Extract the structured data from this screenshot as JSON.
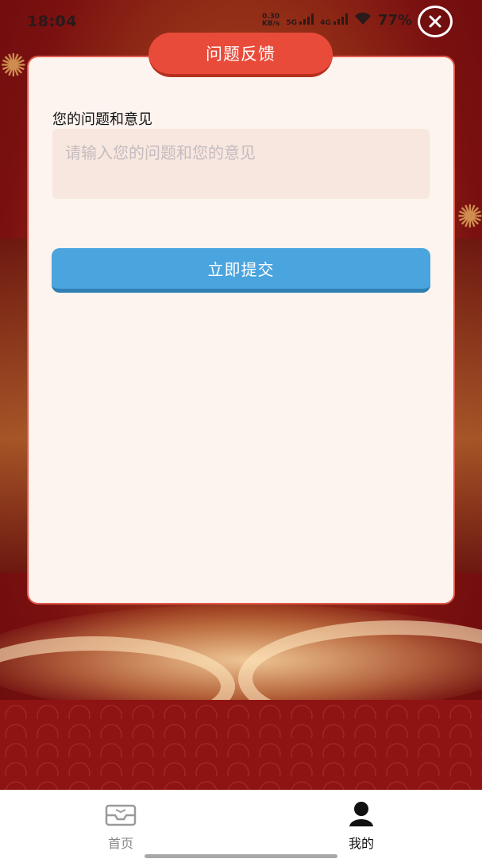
{
  "status_bar": {
    "time": "18:04",
    "net_speed_top": "0.30",
    "net_speed_bottom": "KB/s",
    "sim1_label": "5G",
    "sim2_label": "4G",
    "battery": "77%"
  },
  "dialog": {
    "title": "问题反馈",
    "field_label": "您的问题和意见",
    "textarea_value": "",
    "textarea_placeholder": "请输入您的问题和您的意见",
    "submit_label": "立即提交"
  },
  "tabbar": {
    "items": [
      {
        "label": "首页",
        "icon": "inbox-icon",
        "active": false
      },
      {
        "label": "我的",
        "icon": "user-icon",
        "active": true
      }
    ]
  },
  "colors": {
    "title_tab": "#e94b3a",
    "submit": "#4aa4de",
    "card_bg": "#fdf4ef",
    "textarea_bg": "#f8e7de"
  }
}
